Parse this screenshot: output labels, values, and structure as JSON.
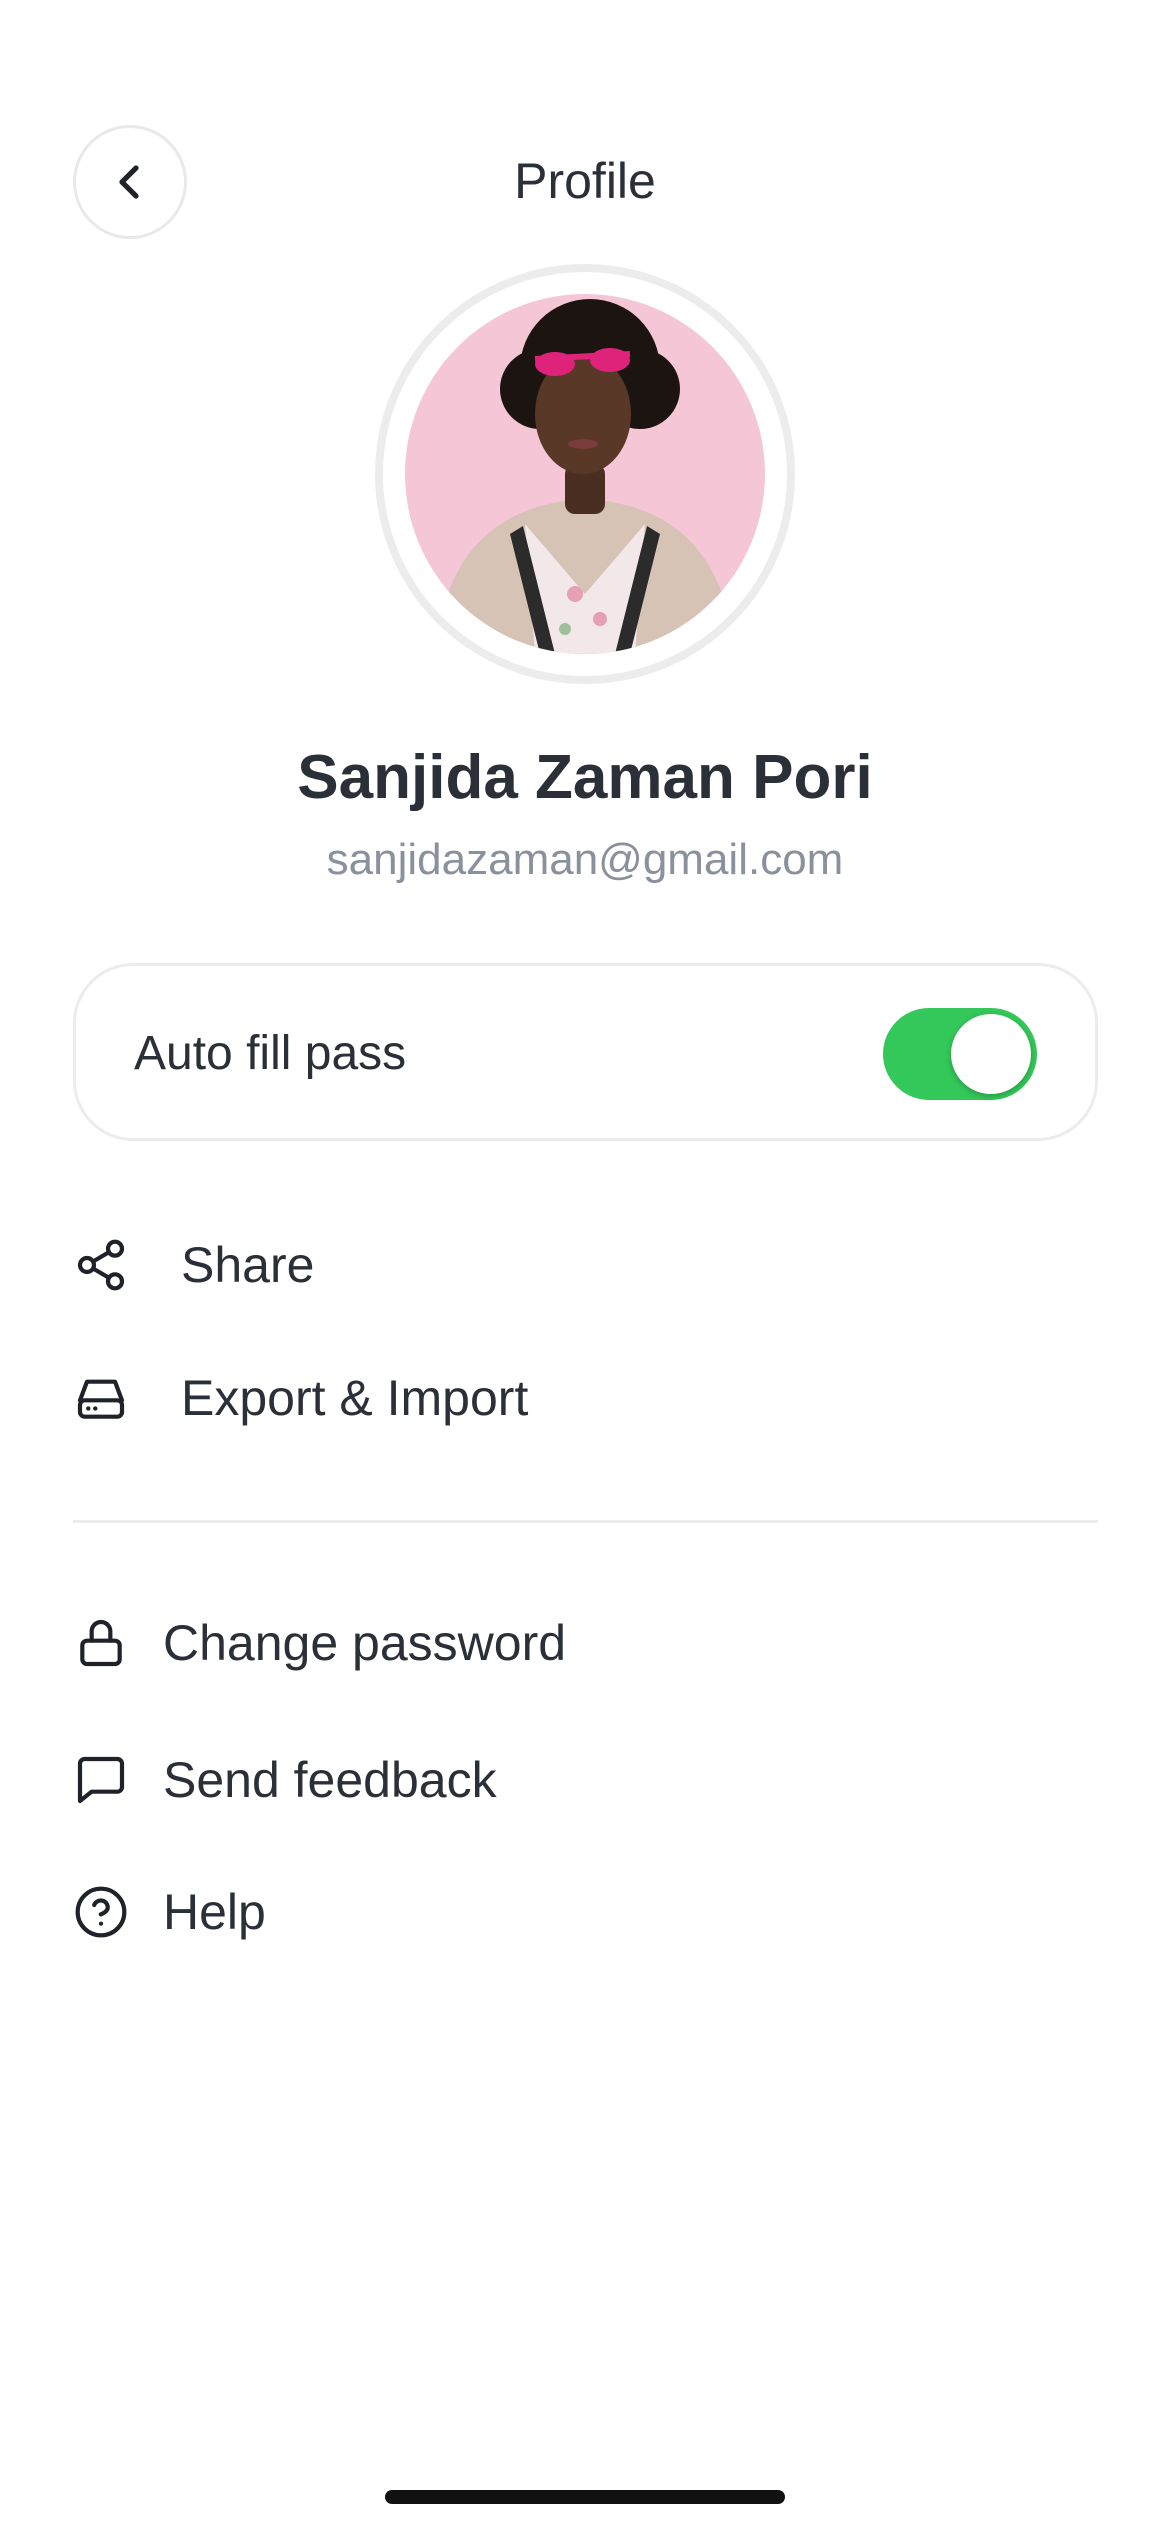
{
  "header": {
    "title": "Profile",
    "back_icon": "chevron-left-icon"
  },
  "profile": {
    "name": "Sanjida Zaman Pori",
    "email": "sanjidazaman@gmail.com"
  },
  "autofill": {
    "label": "Auto fill pass",
    "enabled": true,
    "toggle_color": "#34c759"
  },
  "menu": {
    "share": {
      "label": "Share",
      "icon": "share-icon"
    },
    "export_import": {
      "label": "Export & Import",
      "icon": "hard-drive-icon"
    },
    "change_password": {
      "label": "Change password",
      "icon": "lock-icon"
    },
    "send_feedback": {
      "label": "Send feedback",
      "icon": "message-square-icon"
    },
    "help": {
      "label": "Help",
      "icon": "help-circle-icon"
    }
  }
}
